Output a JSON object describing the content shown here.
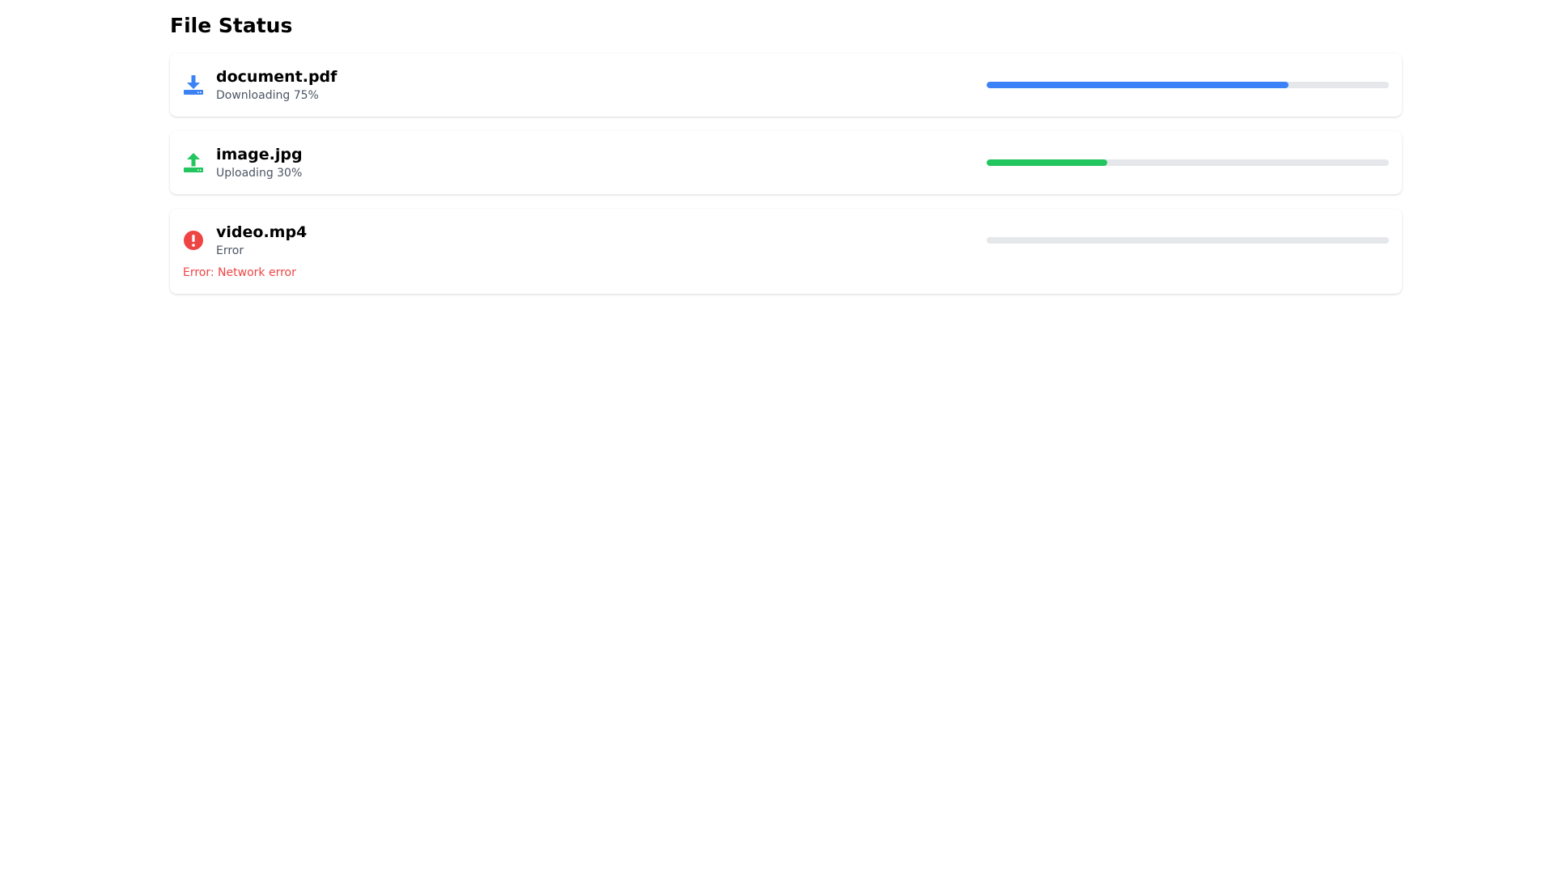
{
  "page": {
    "title": "File Status"
  },
  "files": [
    {
      "name": "document.pdf",
      "status": "Downloading 75%",
      "icon": "download-icon",
      "color": "#3b82f6",
      "progress": 75
    },
    {
      "name": "image.jpg",
      "status": "Uploading 30%",
      "icon": "upload-icon",
      "color": "#22c55e",
      "progress": 30
    },
    {
      "name": "video.mp4",
      "status": "Error",
      "icon": "error-icon",
      "color": "#ef4444",
      "progress": 0,
      "error_message": "Error: Network error"
    }
  ]
}
